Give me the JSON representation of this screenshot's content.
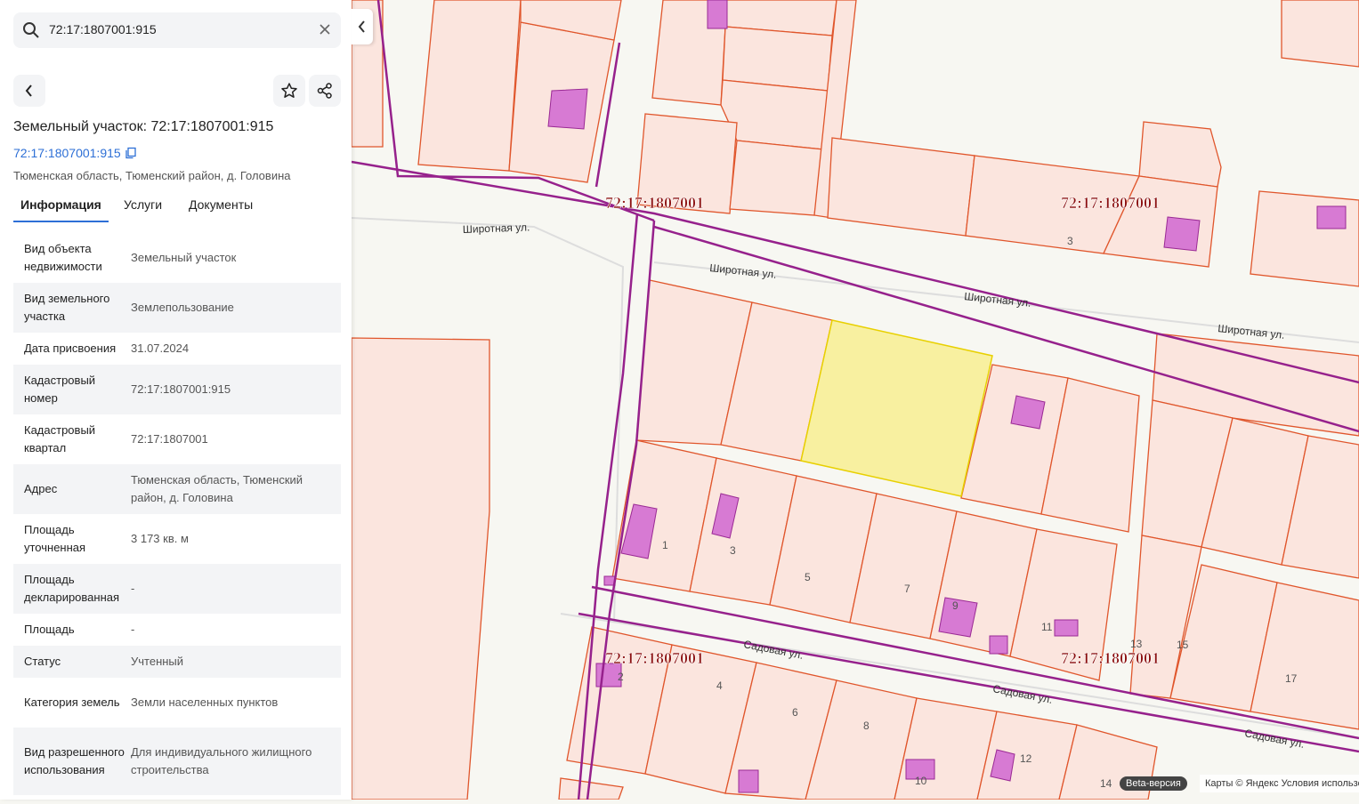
{
  "search": {
    "value": "72:17:1807001:915"
  },
  "object": {
    "title": "Земельный участок: 72:17:1807001:915",
    "cad_link": "72:17:1807001:915",
    "address": "Тюменская область, Тюменский район, д. Головина"
  },
  "tabs": [
    {
      "label": "Информация"
    },
    {
      "label": "Услуги"
    },
    {
      "label": "Документы"
    }
  ],
  "info": [
    {
      "key": "Вид объекта недвижимости",
      "value": "Земельный участок"
    },
    {
      "key": "Вид земельного участка",
      "value": "Землепользование"
    },
    {
      "key": "Дата присвоения",
      "value": "31.07.2024"
    },
    {
      "key": "Кадастровый номер",
      "value": "72:17:1807001:915"
    },
    {
      "key": "Кадастровый квартал",
      "value": "72:17:1807001"
    },
    {
      "key": "Адрес",
      "value": "Тюменская область, Тюменский район, д. Головина"
    },
    {
      "key": "Площадь уточненная",
      "value": "3 173 кв. м"
    },
    {
      "key": "Площадь декларированная",
      "value": "-"
    },
    {
      "key": "Площадь",
      "value": "-"
    },
    {
      "key": "Статус",
      "value": "Учтенный"
    },
    {
      "key": "Категория земель",
      "value": "Земли населенных пунктов"
    },
    {
      "key": "Вид разрешенного использования",
      "value": "Для индивидуального жилищного строительства"
    }
  ],
  "map": {
    "quarter_labels": [
      "72:17:1807001",
      "72:17:1807001",
      "72:17:1807001",
      "72:17:1807001"
    ],
    "street_labels": [
      "Широтная ул.",
      "Широтная ул.",
      "Широтная ул.",
      "Широтная ул.",
      "Садовая ул.",
      "Садовая ул.",
      "Садовая ул."
    ],
    "plot_numbers": [
      "3",
      "1",
      "3",
      "5",
      "7",
      "9",
      "11",
      "13",
      "15",
      "2",
      "4",
      "6",
      "8",
      "10",
      "12",
      "14",
      "17"
    ],
    "beta_badge": "Beta-версия",
    "copyright": "Карты © Яндекс   Условия использования"
  },
  "colors": {
    "accent": "#2d6fd6",
    "parcel_fill": "#fbe5de",
    "parcel_stroke": "#e0562c",
    "selected_fill": "#f8f0a0",
    "building": "#d77ad3",
    "quarter_line": "#96218c",
    "quarter_label": "#8b0f0f"
  }
}
